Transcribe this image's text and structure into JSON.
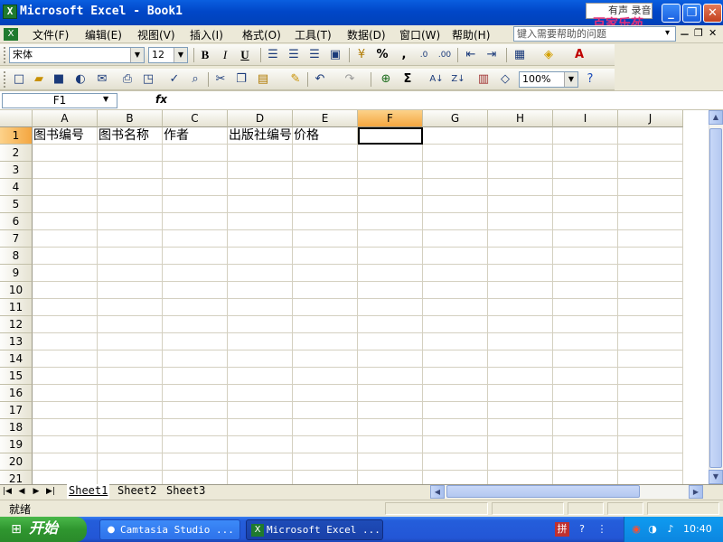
{
  "window": {
    "title": "Microsoft Excel - Book1",
    "app_icon": "X",
    "badge_text": "有声 录音",
    "watermark": "百家乐苑",
    "buttons": {
      "minimize": "_",
      "restore": "❐",
      "close": "✕"
    }
  },
  "menu": {
    "items": [
      "文件(F)",
      "编辑(E)",
      "视图(V)",
      "插入(I)",
      "格式(O)",
      "工具(T)",
      "数据(D)",
      "窗口(W)",
      "帮助(H)"
    ],
    "help_placeholder": "键入需要帮助的问题",
    "doc_controls": [
      "▾",
      "－",
      "❐",
      "✕"
    ]
  },
  "format_toolbar": {
    "font_name": "宋体",
    "font_size": "12",
    "bold": "B",
    "italic": "I",
    "underline": "U",
    "percent": "%",
    "comma": ","
  },
  "standard_toolbar": {
    "zoom": "100%",
    "sum": "Σ"
  },
  "formula_bar": {
    "name_box": "F1",
    "fx": "fx",
    "content": ""
  },
  "grid": {
    "columns": [
      "A",
      "B",
      "C",
      "D",
      "E",
      "F",
      "G",
      "H",
      "I",
      "J"
    ],
    "selected_column": "F",
    "rows": [
      "1",
      "2",
      "3",
      "4",
      "5",
      "6",
      "7",
      "8",
      "9",
      "10",
      "11",
      "12",
      "13",
      "14",
      "15",
      "16",
      "17",
      "18",
      "19",
      "20",
      "21"
    ],
    "selected_row": "1",
    "row1_values": [
      "图书编号",
      "图书名称",
      "作者",
      "出版社编号",
      "价格"
    ],
    "active_cell": "F1"
  },
  "sheets": {
    "tabs": [
      "Sheet1",
      "Sheet2",
      "Sheet3"
    ],
    "active": "Sheet1",
    "nav": [
      "|◀",
      "◀",
      "▶",
      "▶|"
    ]
  },
  "status": {
    "text": "就绪"
  },
  "taskbar": {
    "start_label": "开始",
    "tasks": [
      {
        "label": "Camtasia Studio ..."
      },
      {
        "label": "Microsoft Excel ..."
      }
    ],
    "clock": "10:40"
  }
}
